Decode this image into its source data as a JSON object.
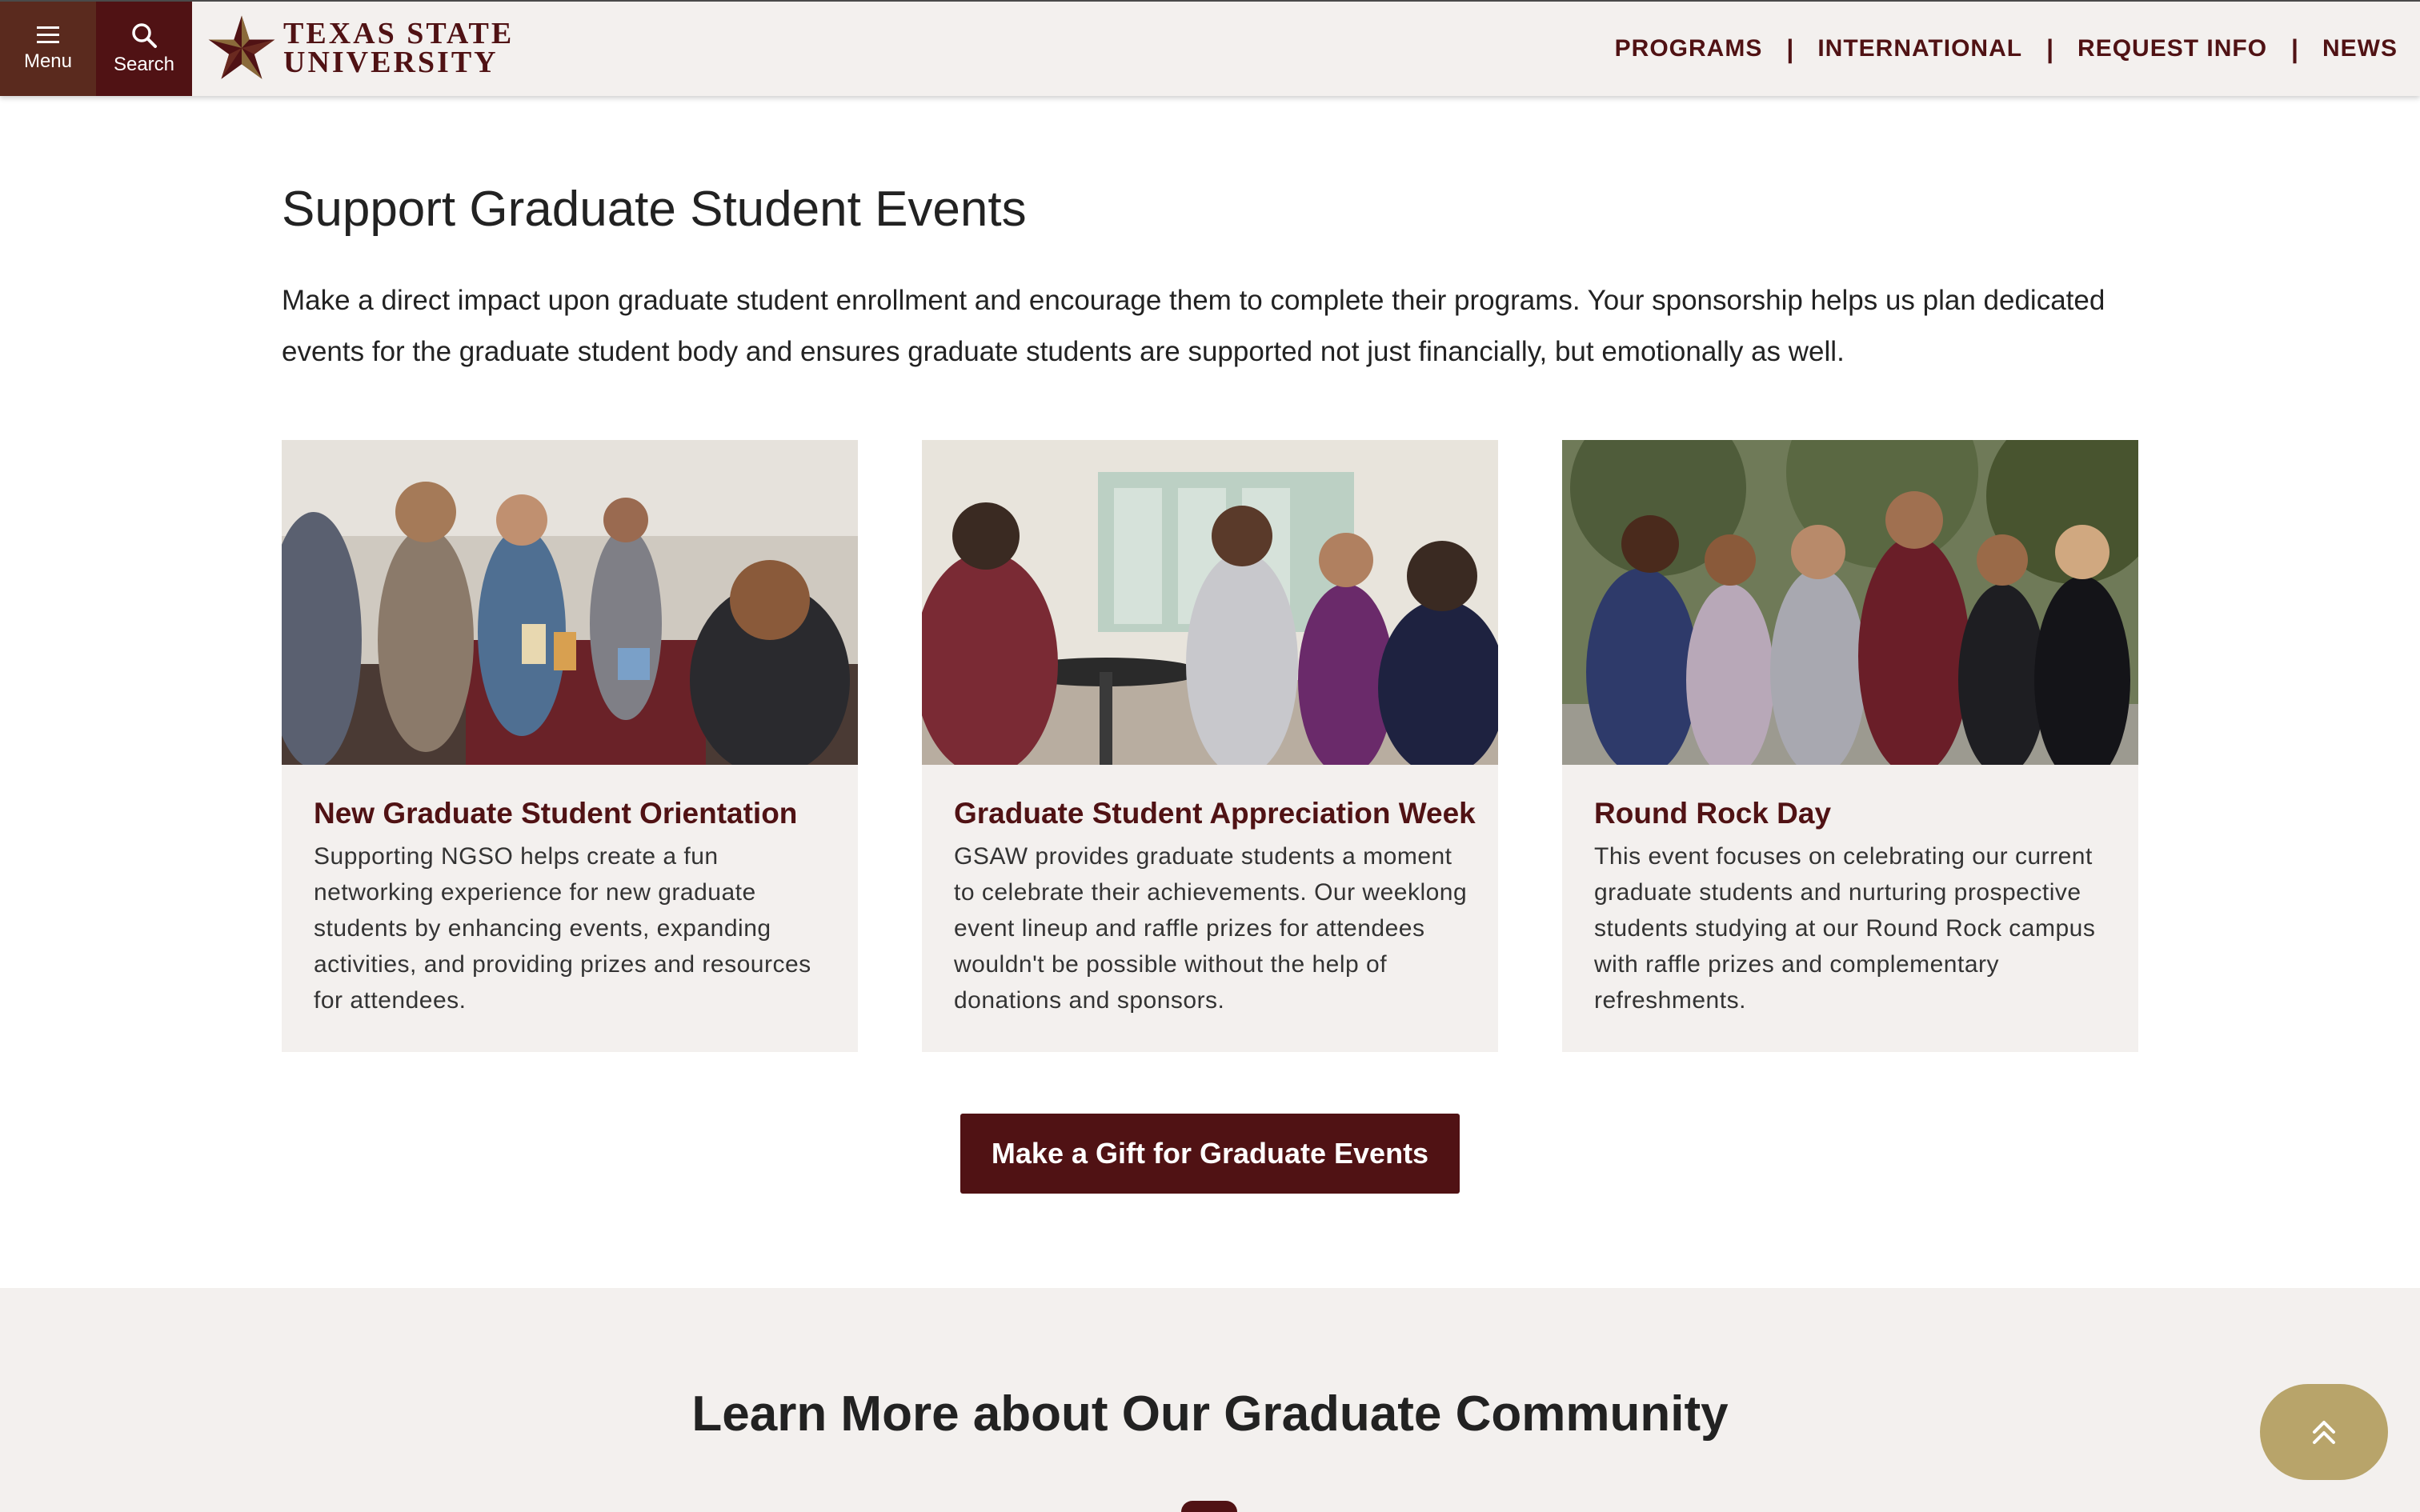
{
  "header": {
    "menu_label": "Menu",
    "search_label": "Search",
    "logo_line1": "TEXAS STATE",
    "logo_line2": "UNIVERSITY",
    "nav": [
      "PROGRAMS",
      "INTERNATIONAL",
      "REQUEST INFO",
      "NEWS"
    ],
    "nav_separator": "|"
  },
  "main": {
    "title": "Support Graduate Student Events",
    "intro": "Make a direct impact upon graduate student enrollment and encourage them to complete their programs. Your sponsorship helps us plan dedicated events for the graduate student body and ensures graduate students are supported not just financially, but emotionally as well.",
    "cards": [
      {
        "title": "New Graduate Student Orientation",
        "body": "Supporting NGSO helps create a fun networking experience for new graduate students by enhancing events, expanding activities, and providing prizes and resources for attendees."
      },
      {
        "title": "Graduate Student Appreciation Week",
        "body": "GSAW provides graduate students a moment to celebrate their achievements. Our weeklong event lineup and raffle prizes for attendees wouldn't be possible without the help of donations and sponsors."
      },
      {
        "title": "Round Rock Day",
        "body": "This event focuses on celebrating our current graduate students and nurturing prospective students studying at our Round Rock campus with raffle prizes and complementary refreshments."
      }
    ],
    "gift_button": "Make a Gift for Graduate Events"
  },
  "community": {
    "title": "Learn More about Our Graduate Community"
  },
  "colors": {
    "maroon": "#501214",
    "brown": "#5a2a1e",
    "gold": "#b8a46a",
    "sand": "#f3f0ee"
  },
  "icons": [
    "hamburger-icon",
    "search-icon",
    "star-icon",
    "double-chevron-up-icon"
  ]
}
